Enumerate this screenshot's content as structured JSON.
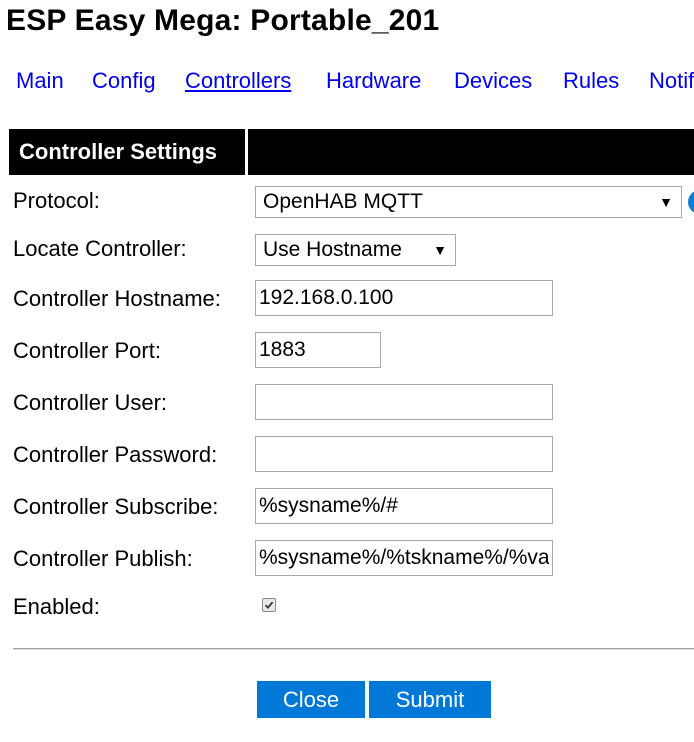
{
  "header": {
    "title": "ESP Easy Mega: Portable_201"
  },
  "nav": {
    "items": [
      {
        "label": "Main"
      },
      {
        "label": "Config"
      },
      {
        "label": "Controllers"
      },
      {
        "label": "Hardware"
      },
      {
        "label": "Devices"
      },
      {
        "label": "Rules"
      },
      {
        "label": "Notifications"
      }
    ],
    "active": "Controllers"
  },
  "section": {
    "title": "Controller Settings"
  },
  "form": {
    "protocol": {
      "label": "Protocol:",
      "value": "OpenHAB MQTT"
    },
    "locate": {
      "label": "Locate Controller:",
      "value": "Use Hostname"
    },
    "hostname": {
      "label": "Controller Hostname:",
      "value": "192.168.0.100"
    },
    "port": {
      "label": "Controller Port:",
      "value": "1883"
    },
    "user": {
      "label": "Controller User:",
      "value": ""
    },
    "password": {
      "label": "Controller Password:",
      "value": ""
    },
    "subscribe": {
      "label": "Controller Subscribe:",
      "value": "%sysname%/#"
    },
    "publish": {
      "label": "Controller Publish:",
      "value": "%sysname%/%tskname%/%valname%"
    },
    "enabled": {
      "label": "Enabled:",
      "checked": true
    }
  },
  "buttons": {
    "close": "Close",
    "submit": "Submit"
  },
  "colors": {
    "link": "#0000ee",
    "header_bg": "#000000",
    "button_bg": "#0078d7",
    "info_icon": "#0e7fd6"
  },
  "icons": {
    "dropdown": "triangle-down",
    "info": "info-circle",
    "check": "checkmark"
  }
}
